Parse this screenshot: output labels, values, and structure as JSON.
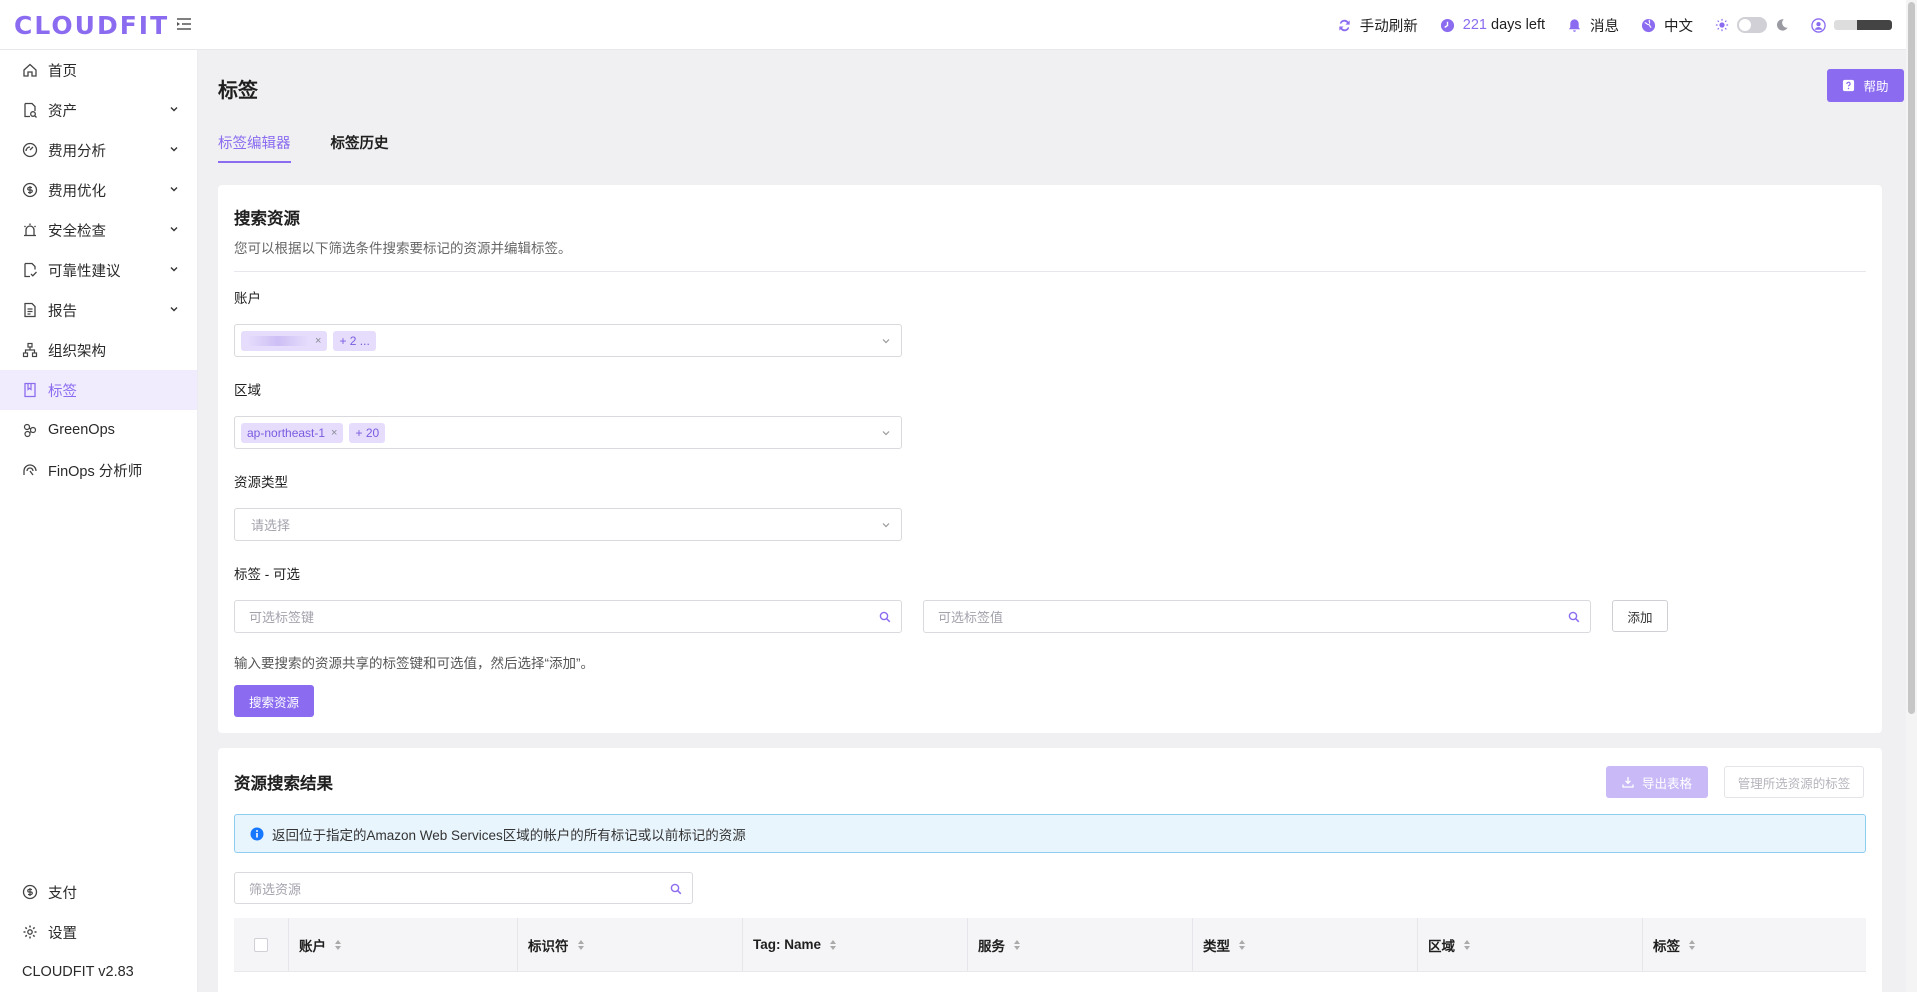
{
  "app": {
    "logo": "CLOUDFIT",
    "version": "CLOUDFIT v2.83"
  },
  "topbar": {
    "refresh_label": "手动刷新",
    "days_number": "221",
    "days_suffix": "days left",
    "messages_label": "消息",
    "language_label": "中文",
    "theme_toggle": "light"
  },
  "sidebar": {
    "items": [
      {
        "label": "首页",
        "icon": "home-icon",
        "expandable": false
      },
      {
        "label": "资产",
        "icon": "asset-search-icon",
        "expandable": true
      },
      {
        "label": "费用分析",
        "icon": "dashboard-gauge-icon",
        "expandable": true
      },
      {
        "label": "费用优化",
        "icon": "dollar-circle-icon",
        "expandable": true
      },
      {
        "label": "安全检查",
        "icon": "alarm-icon",
        "expandable": true
      },
      {
        "label": "可靠性建议",
        "icon": "file-check-icon",
        "expandable": true
      },
      {
        "label": "报告",
        "icon": "document-icon",
        "expandable": true
      },
      {
        "label": "组织架构",
        "icon": "org-chart-icon",
        "expandable": false
      },
      {
        "label": "标签",
        "icon": "book-icon",
        "expandable": false,
        "active": true
      },
      {
        "label": "GreenOps",
        "icon": "nodes-icon",
        "expandable": false
      },
      {
        "label": "FinOps 分析师",
        "icon": "analyst-icon",
        "expandable": false
      }
    ],
    "bottom": [
      {
        "label": "支付",
        "icon": "dollar-circle-icon"
      },
      {
        "label": "设置",
        "icon": "gear-icon"
      }
    ]
  },
  "main": {
    "title": "标签",
    "help_label": "帮助",
    "tabs": [
      {
        "label": "标签编辑器",
        "active": true
      },
      {
        "label": "标签历史",
        "active": false
      }
    ],
    "search": {
      "title": "搜索资源",
      "description": "您可以根据以下筛选条件搜索要标记的资源并编辑标签。",
      "account_label": "账户",
      "account_chips": [
        "+ 2 ..."
      ],
      "region_label": "区域",
      "region_chips": [
        "ap-northeast-1",
        "+ 20"
      ],
      "resource_type_label": "资源类型",
      "resource_type_placeholder": "请选择",
      "tags_label": "标签 - 可选",
      "tag_key_placeholder": "可选标签键",
      "tag_value_placeholder": "可选标签值",
      "add_label": "添加",
      "hint": "输入要搜索的资源共享的标签键和可选值，然后选择“添加”。",
      "search_button": "搜索资源"
    },
    "results": {
      "title": "资源搜索结果",
      "export_label": "导出表格",
      "manage_label": "管理所选资源的标签",
      "info": "返回位于指定的Amazon Web Services区域的帐户的所有标记或以前标记的资源",
      "filter_placeholder": "筛选资源",
      "columns": [
        "账户",
        "标识符",
        "Tag: Name",
        "服务",
        "类型",
        "区域",
        "标签"
      ]
    }
  },
  "colors": {
    "accent": "#8b6cf0",
    "chip_bg": "#e6ddfc",
    "info_bg": "#e9f5fd",
    "info_border": "#8fcdf0"
  }
}
